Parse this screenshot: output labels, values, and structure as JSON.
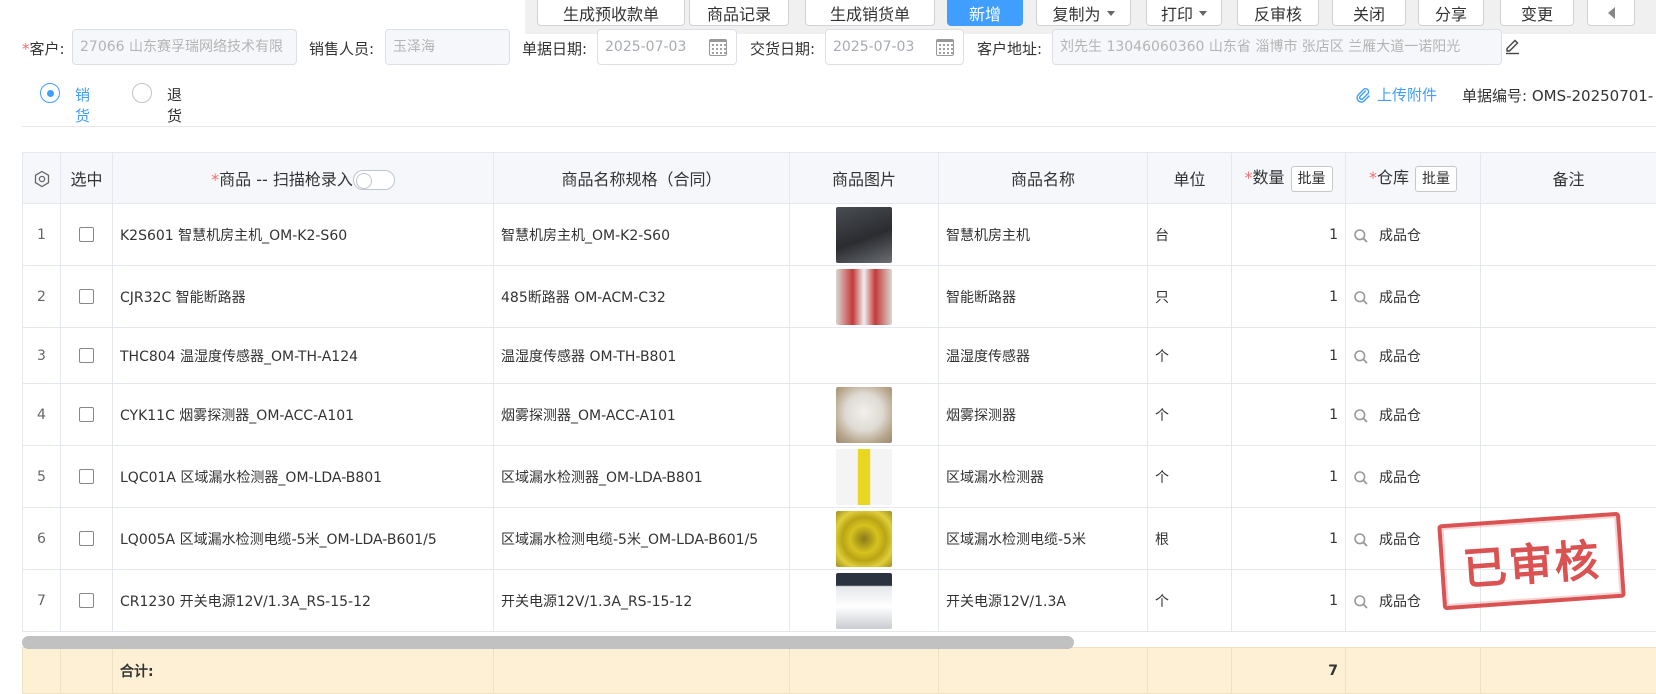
{
  "toolbar": {
    "buttons": [
      {
        "label": "生成预收款单"
      },
      {
        "label": "商品记录"
      },
      {
        "label": "生成销货单"
      },
      {
        "label": "新增"
      },
      {
        "label": "复制为"
      },
      {
        "label": "打印"
      },
      {
        "label": "反审核"
      },
      {
        "label": "关闭"
      },
      {
        "label": "分享"
      },
      {
        "label": "变更"
      }
    ]
  },
  "form": {
    "customer_label": "客户:",
    "customer_value": "27066 山东赛孚瑞网络技术有限",
    "sales_label": "销售人员:",
    "sales_value": "玉泽海",
    "doc_date_label": "单据日期:",
    "doc_date_value": "2025-07-03",
    "delivery_date_label": "交货日期:",
    "delivery_date_value": "2025-07-03",
    "address_label": "客户地址:",
    "address_value": "刘先生 13046060360 山东省 淄博市 张店区 兰雁大道一诺阳光"
  },
  "type_radio": {
    "sale": "销货",
    "return": "退货",
    "selected": "销货"
  },
  "attachment_label": "上传附件",
  "doc_number": "单据编号: OMS-20250701-",
  "table": {
    "headers": {
      "select": "选中",
      "product": "商品 -- 扫描枪录入",
      "spec": "商品名称规格（合同）",
      "image": "商品图片",
      "name": "商品名称",
      "unit": "单位",
      "qty": "数量",
      "warehouse": "仓库",
      "remark": "备注",
      "batch": "批量"
    },
    "rows": [
      {
        "idx": "1",
        "product": "K2S601 智慧机房主机_OM-K2-S60",
        "spec": "智慧机房主机_OM-K2-S60",
        "name": "智慧机房主机",
        "unit": "台",
        "qty": "1",
        "warehouse": "成品仓"
      },
      {
        "idx": "2",
        "product": "CJR32C 智能断路器",
        "spec": "485断路器 OM-ACM-C32",
        "name": "智能断路器",
        "unit": "只",
        "qty": "1",
        "warehouse": "成品仓"
      },
      {
        "idx": "3",
        "product": "THC804 温湿度传感器_OM-TH-A124",
        "spec": "温湿度传感器 OM-TH-B801",
        "name": "温湿度传感器",
        "unit": "个",
        "qty": "1",
        "warehouse": "成品仓"
      },
      {
        "idx": "4",
        "product": "CYK11C 烟雾探测器_OM-ACC-A101",
        "spec": "烟雾探测器_OM-ACC-A101",
        "name": "烟雾探测器",
        "unit": "个",
        "qty": "1",
        "warehouse": "成品仓"
      },
      {
        "idx": "5",
        "product": "LQC01A 区域漏水检测器_OM-LDA-B801",
        "spec": "区域漏水检测器_OM-LDA-B801",
        "name": "区域漏水检测器",
        "unit": "个",
        "qty": "1",
        "warehouse": "成品仓"
      },
      {
        "idx": "6",
        "product": "LQ005A 区域漏水检测电缆-5米_OM-LDA-B601/5",
        "spec": "区域漏水检测电缆-5米_OM-LDA-B601/5",
        "name": "区域漏水检测电缆-5米",
        "unit": "根",
        "qty": "1",
        "warehouse": "成品仓"
      },
      {
        "idx": "7",
        "product": "CR1230 开关电源12V/1.3A_RS-15-12",
        "spec": "开关电源12V/1.3A_RS-15-12",
        "name": "开关电源12V/1.3A",
        "unit": "个",
        "qty": "1",
        "warehouse": "成品仓"
      }
    ],
    "total_label": "合计:",
    "total_qty": "7"
  },
  "stamp_text": "已审核",
  "colors": {
    "primary": "#409eff",
    "required": "#f56c6c",
    "stamp": "#d53b3b",
    "total_row": "#fdf0d4"
  }
}
